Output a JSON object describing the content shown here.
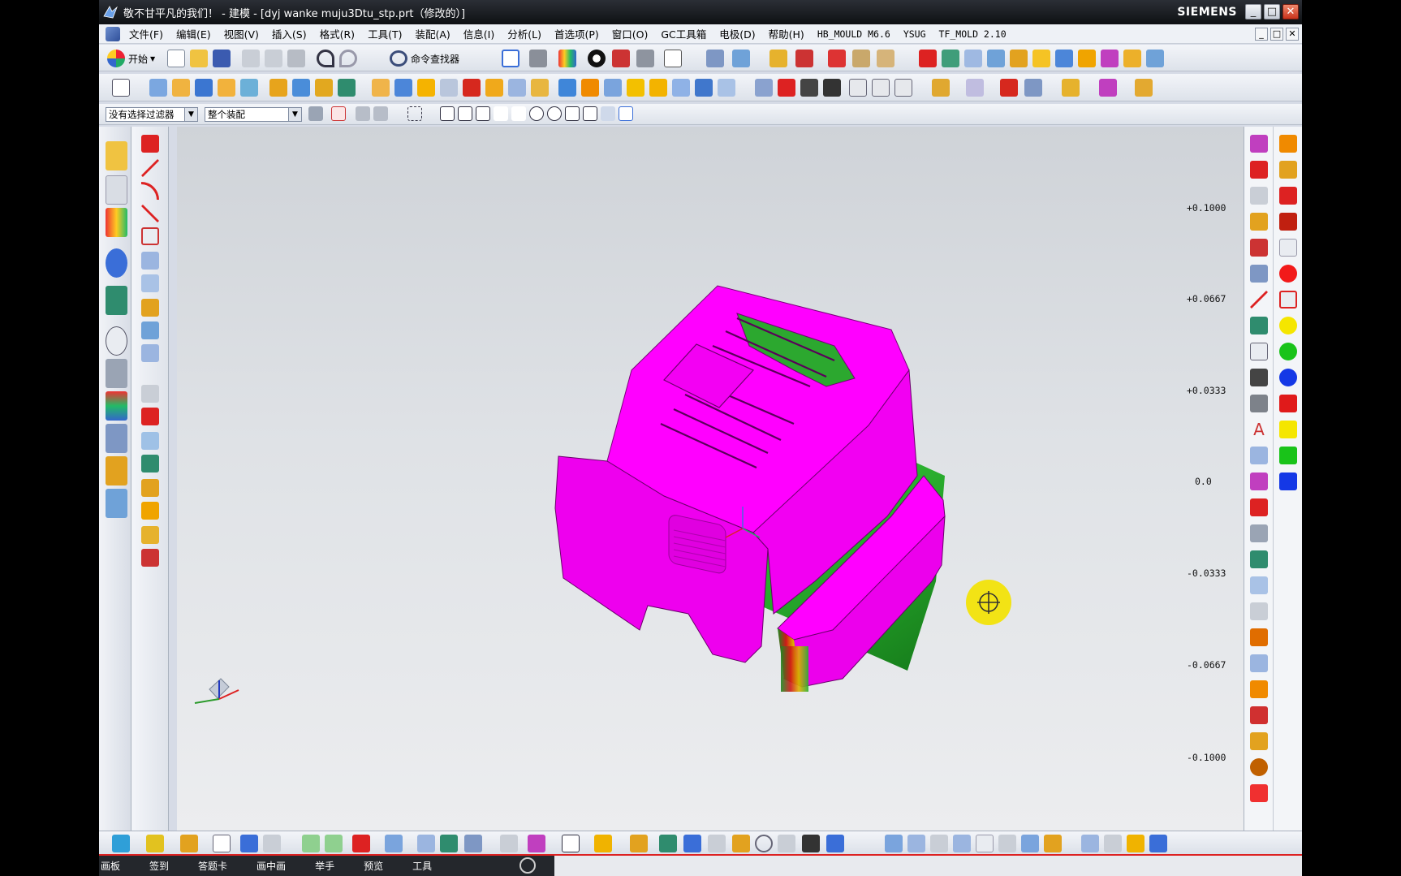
{
  "window": {
    "title": "敬不甘平凡的我们！ - 建模 - [dyj wanke muju3Dtu_stp.prt（修改的）]",
    "brand": "SIEMENS",
    "controls": [
      "_",
      "□",
      "✕"
    ]
  },
  "menubar": {
    "items": [
      "文件(F)",
      "编辑(E)",
      "视图(V)",
      "插入(S)",
      "格式(R)",
      "工具(T)",
      "装配(A)",
      "信息(I)",
      "分析(L)",
      "首选项(P)",
      "窗口(O)",
      "GC工具箱",
      "电极(D)",
      "帮助(H)",
      "HB_MOULD M6.6",
      "YSUG",
      "TF_MOLD 2.10"
    ],
    "mdi_controls": [
      "_",
      "□",
      "✕"
    ]
  },
  "toolbar": {
    "start_label": "开始",
    "finder_label": "命令查找器",
    "selection_filter": "没有选择过滤器",
    "assembly_scope": "整个装配"
  },
  "color_scale": {
    "labels": [
      "+0.1000",
      "+0.0667",
      "+0.0333",
      "0.0",
      "-0.0333",
      "-0.0667",
      "-0.1000"
    ],
    "max": 0.1,
    "min": -0.1
  },
  "model": {
    "primary_color": "#ff00ff",
    "positive_color": "#00c000",
    "negative_color": "#2020c0"
  },
  "taskbar": {
    "items": [
      "画板",
      "签到",
      "答题卡",
      "画中画",
      "举手",
      "预览",
      "工具"
    ]
  }
}
